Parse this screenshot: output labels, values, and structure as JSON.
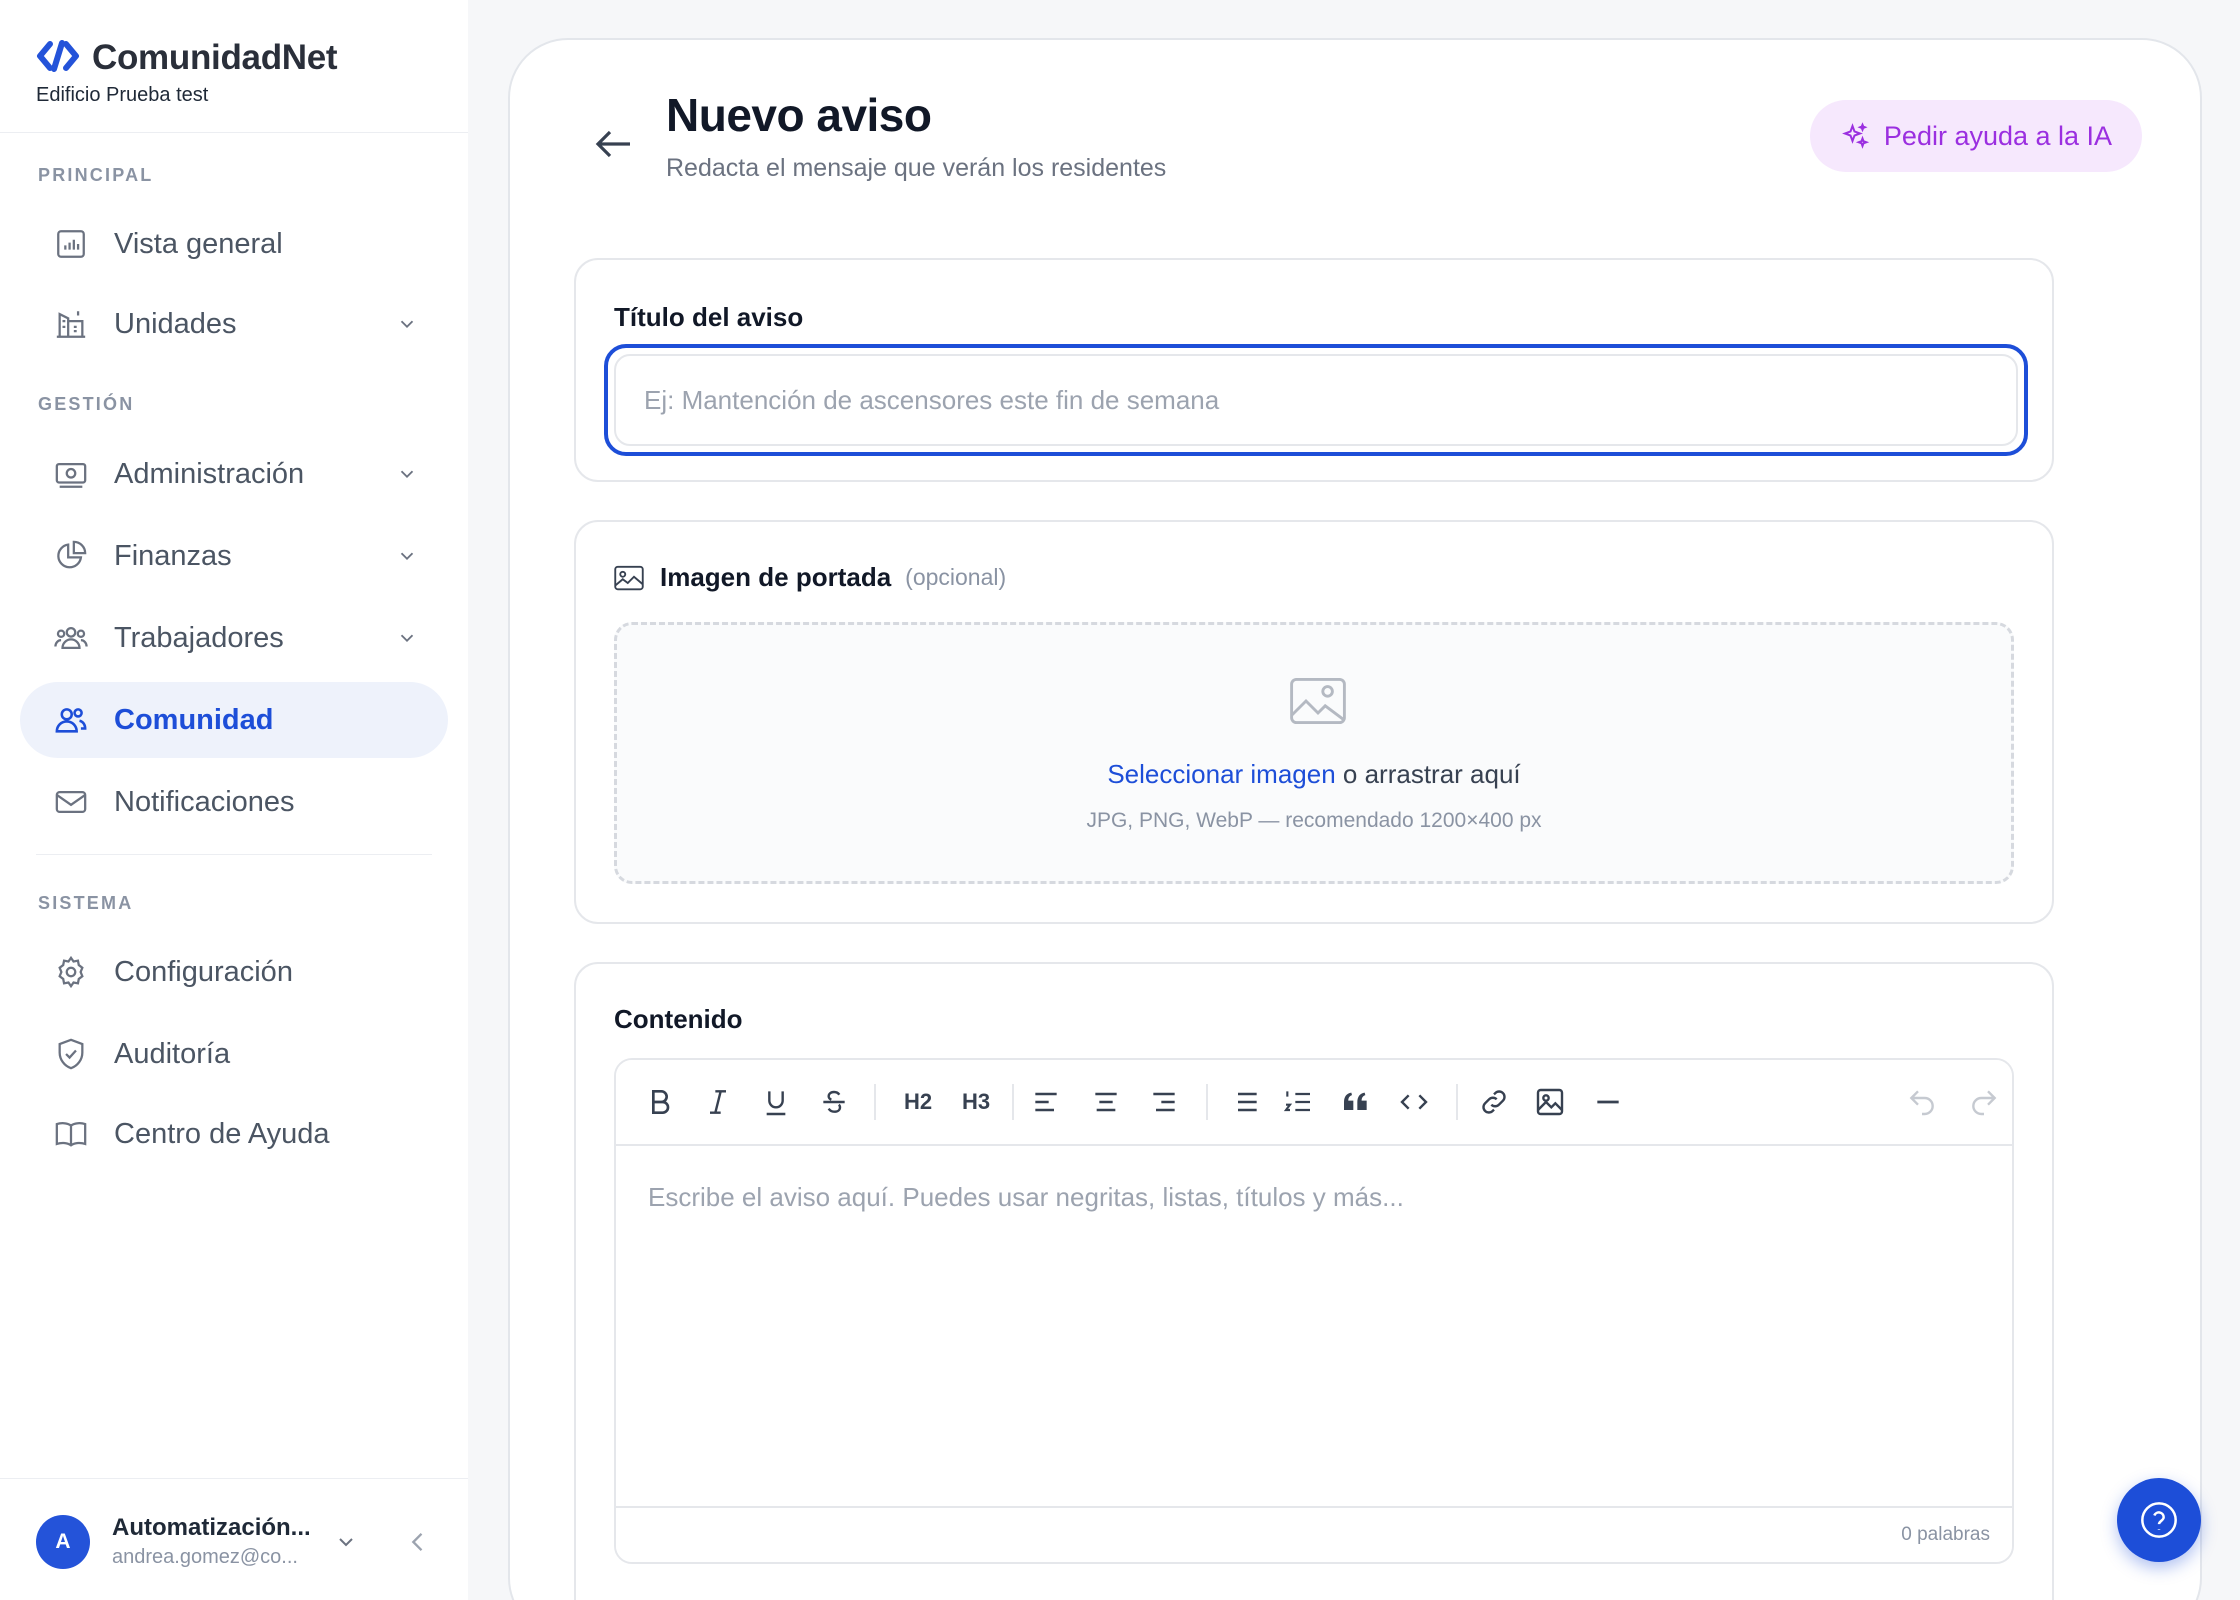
{
  "brand": {
    "name": "ComunidadNet",
    "building": "Edificio Prueba test"
  },
  "sidebar": {
    "sections": {
      "principal": "PRINCIPAL",
      "gestion": "GESTIÓN",
      "sistema": "SISTEMA"
    },
    "items": {
      "vista_general": "Vista general",
      "unidades": "Unidades",
      "administracion": "Administración",
      "finanzas": "Finanzas",
      "trabajadores": "Trabajadores",
      "comunidad": "Comunidad",
      "notificaciones": "Notificaciones",
      "configuracion": "Configuración",
      "auditoria": "Auditoría",
      "centro_ayuda": "Centro de Ayuda"
    },
    "active_item": "Comunidad"
  },
  "user": {
    "initial": "A",
    "name": "Automatización...",
    "email": "andrea.gomez@co..."
  },
  "header": {
    "title": "Nuevo aviso",
    "subtitle": "Redacta el mensaje que verán los residentes",
    "ai_button": "Pedir ayuda a la IA"
  },
  "form": {
    "title_label": "Título del aviso",
    "title_placeholder": "Ej: Mantención de ascensores este fin de semana",
    "title_value": "",
    "cover_label": "Imagen de portada",
    "cover_optional": "(opcional)",
    "cover_select_link": "Seleccionar imagen",
    "cover_drag_text": " o arrastrar aquí",
    "cover_hint": "JPG, PNG, WebP — recomendado 1200×400 px",
    "content_label": "Contenido",
    "content_placeholder": "Escribe el aviso aquí. Puedes usar negritas, listas, títulos y más...",
    "word_count": "0 palabras"
  },
  "toolbar": {
    "h2": "H2",
    "h3": "H3"
  },
  "colors": {
    "accent": "#1d4ed8",
    "ai": "#9b2fe0",
    "ai_bg": "#f6e8fd"
  }
}
